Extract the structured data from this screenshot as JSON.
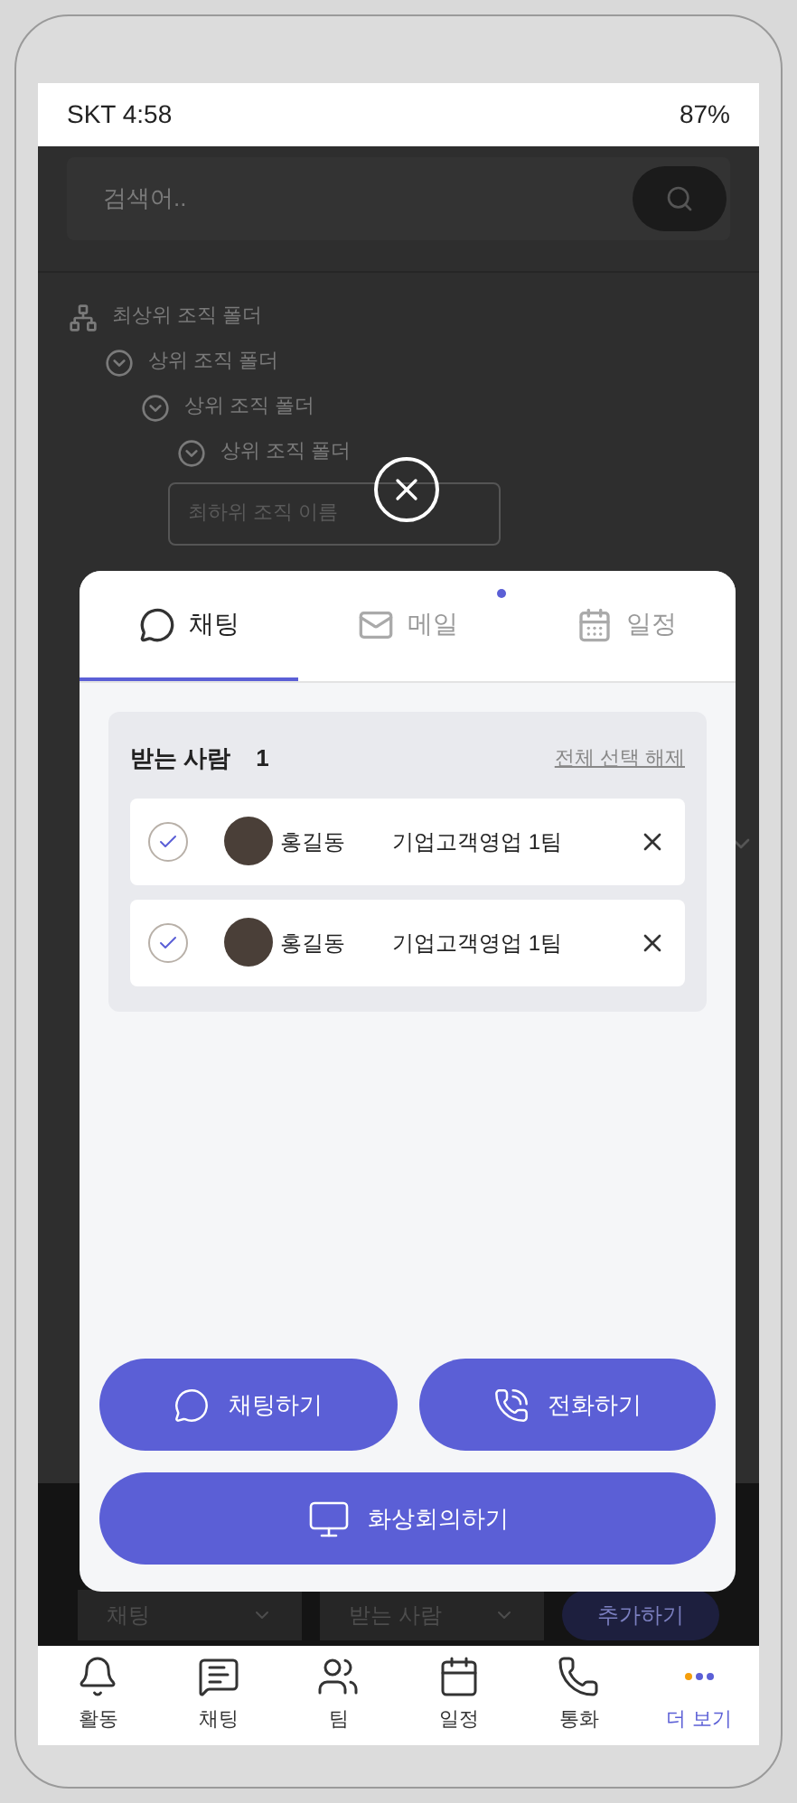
{
  "status_bar": {
    "time": "SKT 4:58",
    "battery": "87%"
  },
  "background": {
    "search": {
      "placeholder": "검색어.."
    },
    "tree": [
      {
        "label": "최상위 조직 폴더",
        "kind": "org",
        "children": [
          {
            "label": "상위 조직 폴더",
            "kind": "folder",
            "expanded": true,
            "children": [
              {
                "label": "상위 조직 폴더",
                "kind": "folder",
                "expanded": true,
                "children": [
                  {
                    "label": "상위 조직 폴더",
                    "kind": "folder",
                    "expanded": true
                  }
                ]
              }
            ]
          }
        ]
      }
    ],
    "leaf_field": {
      "placeholder": "최하위 조직 이름"
    },
    "bottom_bar": {
      "dropdowns": [
        {
          "value": "채팅"
        },
        {
          "value": "받는 사람"
        }
      ],
      "button": "추가하기"
    }
  },
  "modal": {
    "tabs": [
      {
        "label": "채팅",
        "kind": "chat",
        "selected": true,
        "unread": false
      },
      {
        "label": "메일",
        "kind": "mail",
        "selected": false,
        "unread": true
      },
      {
        "label": "일정",
        "kind": "calendar",
        "selected": false,
        "unread": false
      }
    ],
    "recipients": {
      "title": "받는 사람",
      "count": "1",
      "clear_link": "전체 선택 해제",
      "items": [
        {
          "name": "홍길동",
          "team": "기업고객영업 1팀",
          "checked": true
        },
        {
          "name": "홍길동",
          "team": "기업고객영업 1팀",
          "checked": true
        }
      ]
    },
    "actions": [
      {
        "label": "채팅하기",
        "kind": "chat"
      },
      {
        "label": "전화하기",
        "kind": "call"
      },
      {
        "label": "화상회의하기",
        "kind": "video"
      }
    ]
  },
  "nav": [
    {
      "label": "활동",
      "kind": "bell",
      "selected": false
    },
    {
      "label": "채팅",
      "kind": "chat",
      "selected": false
    },
    {
      "label": "팀",
      "kind": "team",
      "selected": false
    },
    {
      "label": "일정",
      "kind": "calendar",
      "selected": false
    },
    {
      "label": "통화",
      "kind": "phone",
      "selected": false
    },
    {
      "label": "더 보기",
      "kind": "more",
      "selected": true
    }
  ]
}
